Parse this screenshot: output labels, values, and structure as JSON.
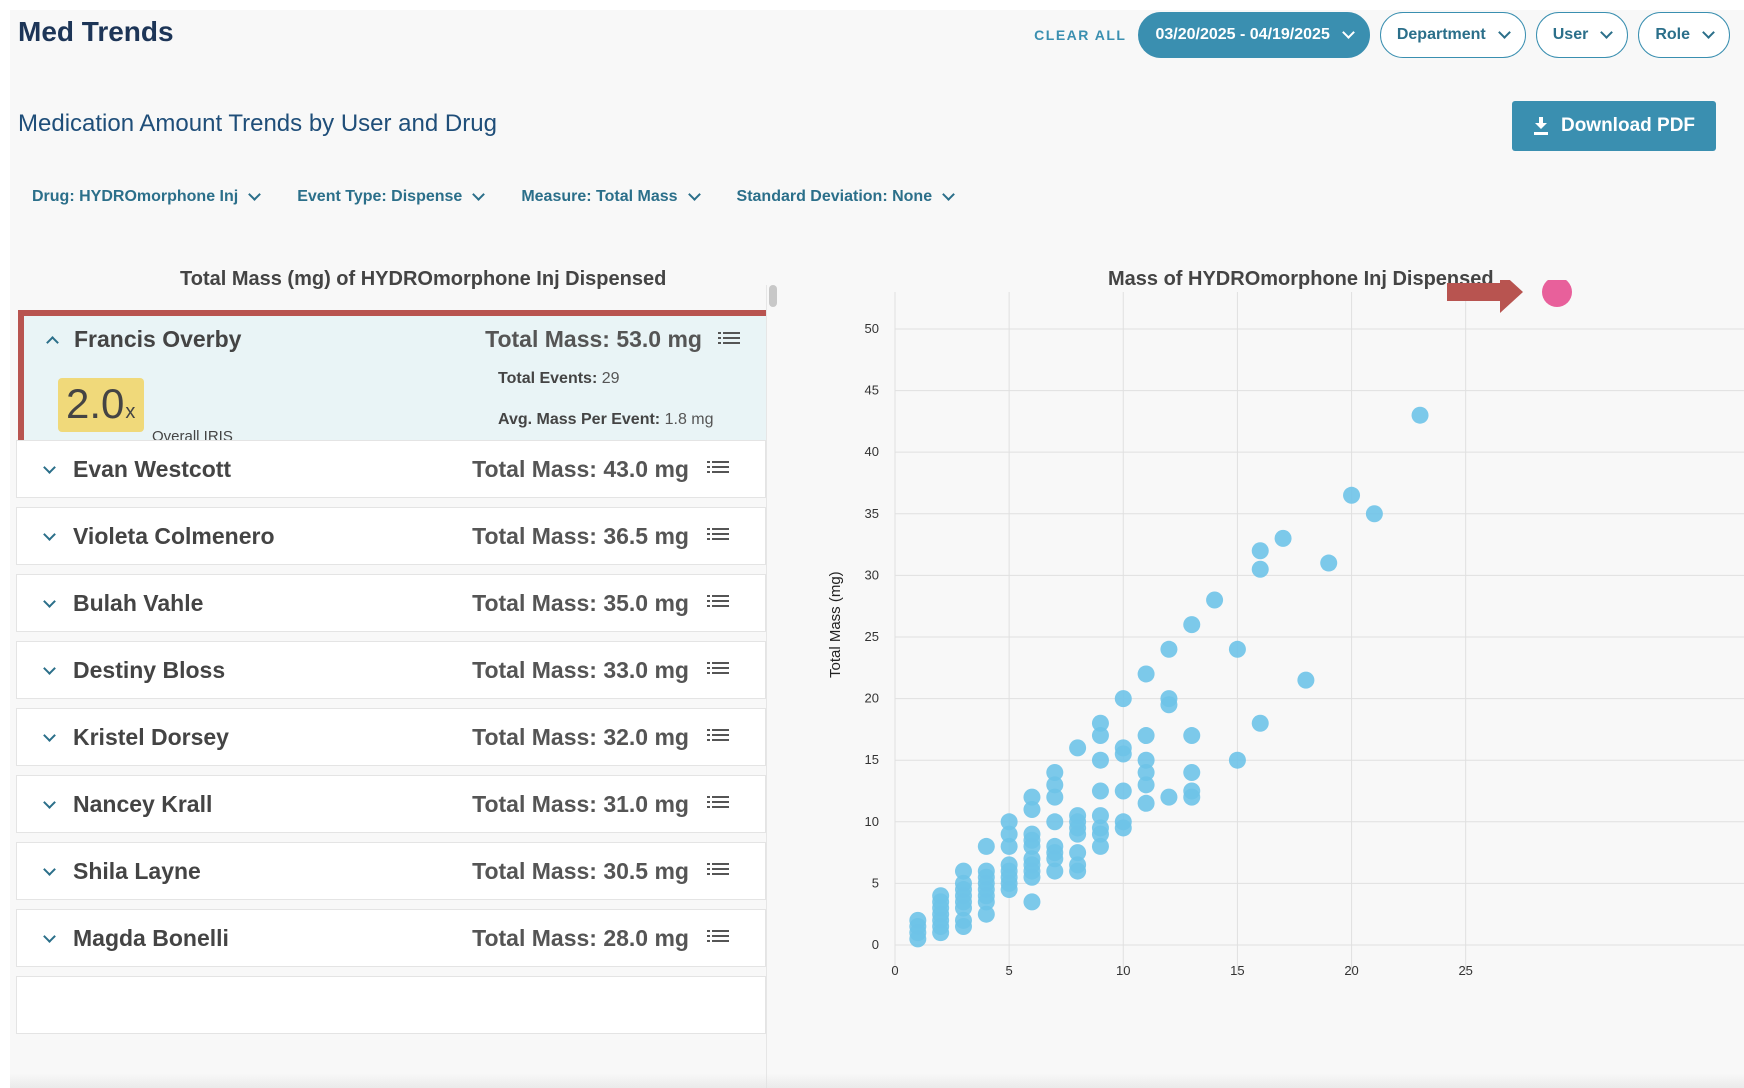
{
  "header": {
    "title": "Med Trends",
    "clear_all": "CLEAR ALL",
    "date_range": "03/20/2025 - 04/19/2025",
    "filters": [
      "Department",
      "User",
      "Role"
    ]
  },
  "report": {
    "subtitle": "Medication Amount Trends by User and Drug",
    "download_label": "Download PDF",
    "sub_filters": [
      "Drug: HYDROmorphone Inj",
      "Event Type: Dispense",
      "Measure: Total Mass",
      "Standard Deviation: None"
    ]
  },
  "list_panel": {
    "title": "Total Mass (mg) of HYDROmorphone Inj Dispensed",
    "expanded": {
      "name": "Francis Overby",
      "total_mass": "Total Mass: 53.0 mg",
      "total_events_label": "Total Events:",
      "total_events_value": "29",
      "avg_label": "Avg. Mass Per Event:",
      "avg_value": "1.8 mg",
      "iris_value": "2.0",
      "iris_suffix": "x",
      "iris_label": "Overall IRIS"
    },
    "rows": [
      {
        "name": "Evan Westcott",
        "mass": "Total Mass: 43.0 mg"
      },
      {
        "name": "Violeta Colmenero",
        "mass": "Total Mass: 36.5 mg"
      },
      {
        "name": "Bulah Vahle",
        "mass": "Total Mass: 35.0 mg"
      },
      {
        "name": "Destiny Bloss",
        "mass": "Total Mass: 33.0 mg"
      },
      {
        "name": "Kristel Dorsey",
        "mass": "Total Mass: 32.0 mg"
      },
      {
        "name": "Nancey Krall",
        "mass": "Total Mass: 31.0 mg"
      },
      {
        "name": "Shila Layne",
        "mass": "Total Mass: 30.5 mg"
      },
      {
        "name": "Magda Bonelli",
        "mass": "Total Mass: 28.0 mg"
      }
    ]
  },
  "colors": {
    "accent": "#3a8fb0",
    "highlight_border": "#b85450",
    "iris_badge": "#f0d97a",
    "point": "#6ec3e8",
    "highlight_point": "#e8609b",
    "arrow": "#b85450"
  },
  "chart_data": {
    "type": "scatter",
    "title": "Mass of HYDROmorphone Inj Dispensed",
    "xlabel": "",
    "ylabel": "Total Mass (mg)",
    "xlim": [
      0,
      29
    ],
    "ylim": [
      0,
      53
    ],
    "x_ticks": [
      0,
      5,
      10,
      15,
      20,
      25
    ],
    "y_ticks": [
      0,
      5,
      10,
      15,
      20,
      25,
      30,
      35,
      40,
      45,
      50
    ],
    "grid": true,
    "highlight": {
      "x": 29,
      "y": 53
    },
    "points": [
      [
        23,
        43
      ],
      [
        20,
        36.5
      ],
      [
        21,
        35
      ],
      [
        17,
        33
      ],
      [
        16,
        32
      ],
      [
        16,
        30.5
      ],
      [
        19,
        31
      ],
      [
        14,
        28
      ],
      [
        13,
        26
      ],
      [
        12,
        24
      ],
      [
        15,
        24
      ],
      [
        18,
        21.5
      ],
      [
        11,
        22
      ],
      [
        10,
        20
      ],
      [
        12,
        20
      ],
      [
        12,
        19.5
      ],
      [
        9,
        18
      ],
      [
        9,
        17
      ],
      [
        11,
        17
      ],
      [
        13,
        17
      ],
      [
        16,
        18
      ],
      [
        8,
        16
      ],
      [
        10,
        16
      ],
      [
        10,
        15.5
      ],
      [
        9,
        15
      ],
      [
        11,
        15
      ],
      [
        15,
        15
      ],
      [
        11,
        14
      ],
      [
        13,
        14
      ],
      [
        7,
        14
      ],
      [
        11,
        13
      ],
      [
        7,
        13
      ],
      [
        9,
        12.5
      ],
      [
        10,
        12.5
      ],
      [
        13,
        12.5
      ],
      [
        12,
        12
      ],
      [
        13,
        12
      ],
      [
        6,
        12
      ],
      [
        7,
        12
      ],
      [
        11,
        11.5
      ],
      [
        6,
        11
      ],
      [
        9,
        10.5
      ],
      [
        8,
        10.5
      ],
      [
        10,
        10
      ],
      [
        10,
        9.5
      ],
      [
        5,
        10
      ],
      [
        8,
        10
      ],
      [
        7,
        10
      ],
      [
        9,
        9.5
      ],
      [
        8,
        9.5
      ],
      [
        9,
        9
      ],
      [
        6,
        9
      ],
      [
        5,
        9
      ],
      [
        8,
        9
      ],
      [
        7,
        8
      ],
      [
        6,
        8.5
      ],
      [
        9,
        8
      ],
      [
        4,
        8
      ],
      [
        6,
        8
      ],
      [
        5,
        8
      ],
      [
        7,
        7.5
      ],
      [
        6,
        7
      ],
      [
        8,
        7.5
      ],
      [
        7,
        7
      ],
      [
        8,
        6.5
      ],
      [
        7,
        6
      ],
      [
        6,
        6.5
      ],
      [
        5,
        6.5
      ],
      [
        3,
        6
      ],
      [
        4,
        6
      ],
      [
        8,
        6
      ],
      [
        6,
        6
      ],
      [
        5,
        6
      ],
      [
        4,
        5.5
      ],
      [
        5,
        5.5
      ],
      [
        6,
        5.5
      ],
      [
        3,
        5
      ],
      [
        4,
        5
      ],
      [
        5,
        5
      ],
      [
        3,
        4.5
      ],
      [
        4,
        4.5
      ],
      [
        5,
        4.5
      ],
      [
        2,
        4
      ],
      [
        3,
        4
      ],
      [
        4,
        4
      ],
      [
        2,
        3.5
      ],
      [
        6,
        3.5
      ],
      [
        3,
        3.5
      ],
      [
        4,
        3.5
      ],
      [
        2,
        3
      ],
      [
        3,
        3
      ],
      [
        1,
        2
      ],
      [
        2,
        2.5
      ],
      [
        4,
        2.5
      ],
      [
        3,
        2
      ],
      [
        2,
        2
      ],
      [
        1,
        1.5
      ],
      [
        3,
        1.5
      ],
      [
        2,
        1.5
      ],
      [
        1,
        1
      ],
      [
        2,
        1
      ],
      [
        1,
        0.5
      ]
    ]
  }
}
